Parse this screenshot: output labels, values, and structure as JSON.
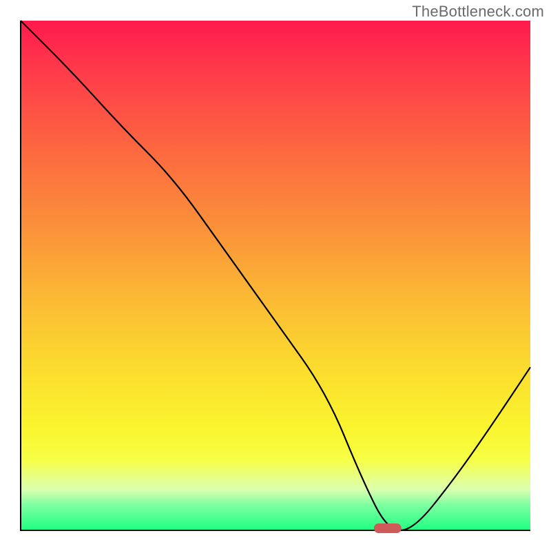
{
  "watermark": "TheBottleneck.com",
  "chart_data": {
    "type": "line",
    "title": "",
    "xlabel": "",
    "ylabel": "",
    "xlim": [
      0,
      100
    ],
    "ylim": [
      0,
      100
    ],
    "grid": false,
    "legend": false,
    "background": "gradient red-yellow-green (top to bottom)",
    "marker": {
      "x": 72,
      "y": 0,
      "color": "#ce5a5a",
      "shape": "rounded-pill"
    },
    "series": [
      {
        "name": "bottleneck-curve",
        "x": [
          0,
          10,
          20,
          30,
          40,
          50,
          60,
          67,
          72,
          77,
          85,
          92,
          100
        ],
        "y": [
          100,
          90,
          79,
          69,
          55,
          41,
          27,
          10,
          0,
          0,
          10,
          20,
          32
        ]
      }
    ]
  }
}
